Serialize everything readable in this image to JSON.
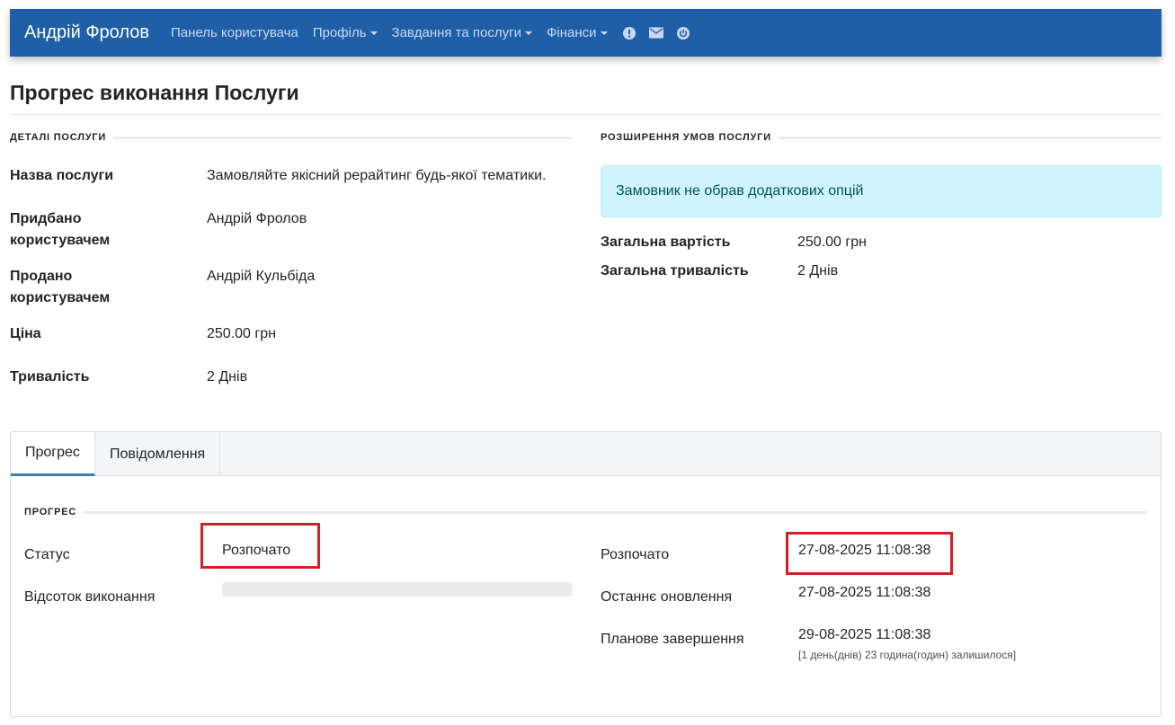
{
  "navbar": {
    "brand": "Андрій Фролов",
    "items": [
      {
        "label": "Панель користувача",
        "dropdown": false
      },
      {
        "label": "Профіль",
        "dropdown": true
      },
      {
        "label": "Завдання та послуги",
        "dropdown": true
      },
      {
        "label": "Фінанси",
        "dropdown": true
      }
    ],
    "icons": [
      "alert-icon",
      "mail-icon",
      "power-icon"
    ],
    "bg_color": "#1f5fa8"
  },
  "page": {
    "title": "Прогрес виконання Послуги"
  },
  "details": {
    "header": "ДЕТАЛІ ПОСЛУГИ",
    "rows": [
      {
        "label": "Назва послуги",
        "value": "Замовляйте якісний рерайтинг будь-якої тематики."
      },
      {
        "label": "Придбано користувачем",
        "value": "Андрій Фролов"
      },
      {
        "label": "Продано користувачем",
        "value": "Андрій Кульбіда"
      },
      {
        "label": "Ціна",
        "value": "250.00 грн"
      },
      {
        "label": "Тривалість",
        "value": "2 Днів"
      }
    ]
  },
  "extensions": {
    "header": "РОЗШИРЕННЯ УМОВ ПОСЛУГИ",
    "alert": "Замовник не обрав додаткових опцій",
    "rows": [
      {
        "label": "Загальна вартість",
        "value": "250.00 грн"
      },
      {
        "label": "Загальна тривалість",
        "value": "2 Днів"
      }
    ]
  },
  "tabs": [
    {
      "label": "Прогрес",
      "active": true
    },
    {
      "label": "Повідомлення",
      "active": false
    }
  ],
  "progress": {
    "header": "ПРОГРЕС",
    "status_label": "Статус",
    "status_value": "Розпочато",
    "percent_label": "Відсоток виконання",
    "percent_value": 0,
    "started_label": "Розпочато",
    "started_value": "27-08-2025 11:08:38",
    "updated_label": "Останнє оновлення",
    "updated_value": "27-08-2025 11:08:38",
    "planned_label": "Планове завершення",
    "planned_value": "29-08-2025 11:08:38",
    "remaining_note": "[1 день(днів) 23 година(годин) залишилося]"
  },
  "highlight_color": "#d0202a"
}
